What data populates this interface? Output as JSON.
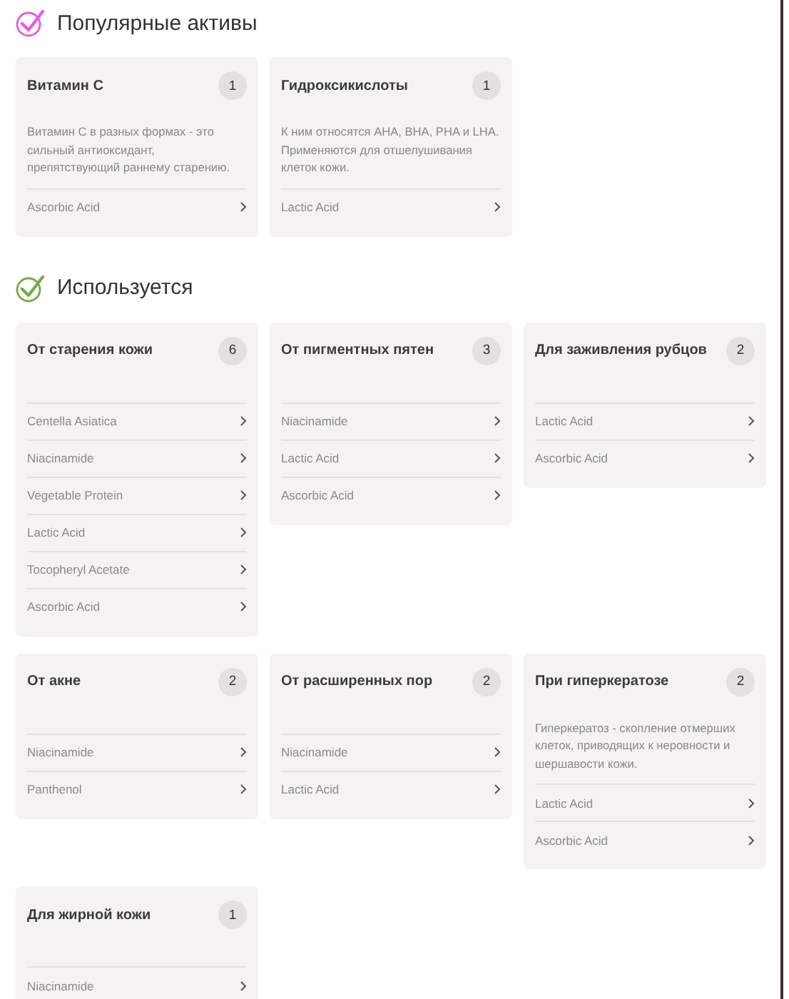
{
  "sections": [
    {
      "title": "Популярные активы",
      "color": "#e85be0",
      "cards": [
        {
          "title": "Витамин С",
          "count": "1",
          "description": "Витамин С в разных формах - это сильный антиоксидант, препятствующий раннему старению.",
          "items": [
            "Ascorbic Acid"
          ]
        },
        {
          "title": "Гидроксикислоты",
          "count": "1",
          "description": "К ним относятся AHA, BHA, PHA и LHA. Применяются для отшелушивания клеток кожи.",
          "items": [
            "Lactic Acid"
          ]
        }
      ]
    },
    {
      "title": "Используется",
      "color": "#7aa84a",
      "cards": [
        {
          "title": "От старения кожи",
          "count": "6",
          "items": [
            "Centella Asiatica",
            "Niacinamide",
            "Vegetable Protein",
            "Lactic Acid",
            "Tocopheryl Acetate",
            "Ascorbic Acid"
          ]
        },
        {
          "title": "От пигментных пятен",
          "count": "3",
          "items": [
            "Niacinamide",
            "Lactic Acid",
            "Ascorbic Acid"
          ]
        },
        {
          "title": "Для заживления рубцов",
          "count": "2",
          "items": [
            "Lactic Acid",
            "Ascorbic Acid"
          ]
        },
        {
          "title": "От акне",
          "count": "2",
          "items": [
            "Niacinamide",
            "Panthenol"
          ]
        },
        {
          "title": "От расширенных пор",
          "count": "2",
          "items": [
            "Niacinamide",
            "Lactic Acid"
          ]
        },
        {
          "title": "При гиперкератозе",
          "count": "2",
          "description": "Гиперкератоз - скопление отмерших клеток, приводящих к неровности и шершавости кожи.",
          "items": [
            "Lactic Acid",
            "Ascorbic Acid"
          ]
        },
        {
          "title": "Для жирной кожи",
          "count": "1",
          "items": [
            "Niacinamide"
          ]
        }
      ]
    }
  ]
}
